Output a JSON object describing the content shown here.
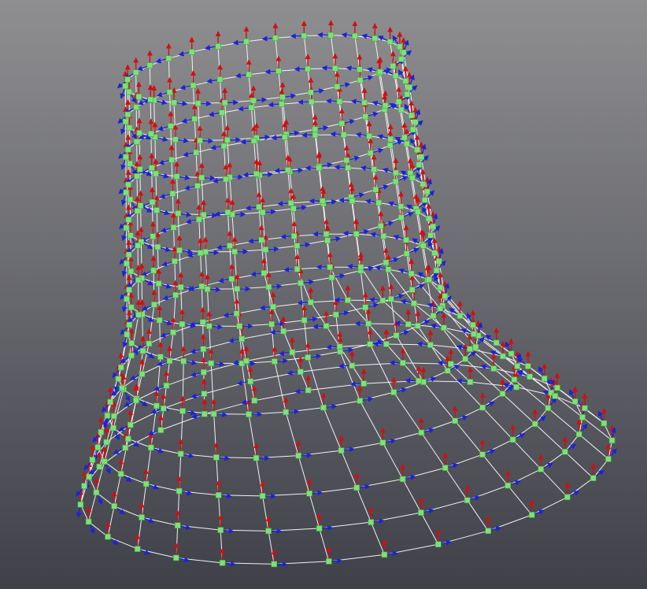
{
  "viewport": {
    "background_top": "#8f8f91",
    "background_bottom": "#3f4049",
    "mesh": {
      "rings": 13,
      "segments": 30,
      "wire_color": "#f2f2f2",
      "vertex_color": "#7fe07a",
      "vertex_edge_color": "#3aa83a",
      "normal_color": "#d01010",
      "tangent_color": "#1c23d6",
      "bitangent_color": "#22c022"
    }
  }
}
